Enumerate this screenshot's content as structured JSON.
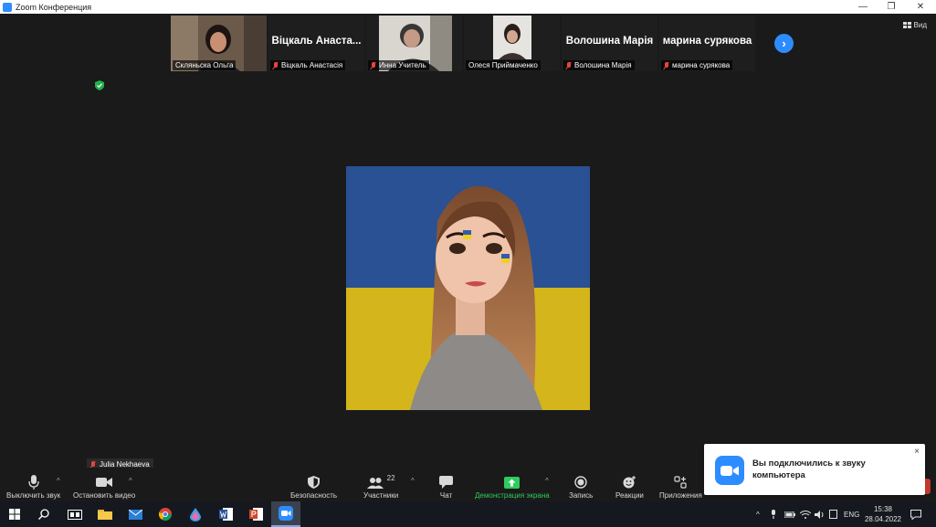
{
  "window": {
    "title": "Zoom Конференция",
    "controls": {
      "minimize": "—",
      "maximize": "❐",
      "close": "✕"
    }
  },
  "view_button": "Вид",
  "participants_strip": [
    {
      "kind": "video",
      "name": "Скляньска Ольга",
      "muted": false
    },
    {
      "kind": "name",
      "display": "Віцкаль Анаста...",
      "name": "Віцкаль Анастасія",
      "muted": true
    },
    {
      "kind": "video",
      "name": "Инна Учитель",
      "muted": true
    },
    {
      "kind": "video",
      "name": "Олеся Приймаченко",
      "muted": false
    },
    {
      "kind": "name",
      "display": "Волошина Марія",
      "name": "Волошина Марія",
      "muted": true
    },
    {
      "kind": "name",
      "display": "марина сурякова",
      "name": "марина сурякова",
      "muted": true
    }
  ],
  "next_page_icon": "chevron-right-icon",
  "active_speaker": {
    "name": "Julia Nekhaeva",
    "muted": true
  },
  "toolbar": {
    "mute": "Выключить звук",
    "stop_video": "Остановить видео",
    "security": "Безопасность",
    "participants": "Участники",
    "participants_count": "22",
    "chat": "Чат",
    "share_screen": "Демонстрация экрана",
    "record": "Запись",
    "reactions": "Реакции",
    "apps": "Приложения",
    "share_color": "#2ecc5e"
  },
  "notification": {
    "text": "Вы подключились к звуку компьютера",
    "close": "×"
  },
  "taskbar": {
    "language": "ENG",
    "time": "15:38",
    "date": "28.04.2022",
    "tray_expand": "^"
  },
  "colors": {
    "accent": "#2d8cff",
    "mute_red": "#e8453c",
    "flag_blue": "#2f5da8",
    "flag_yellow": "#f2cf1f"
  }
}
